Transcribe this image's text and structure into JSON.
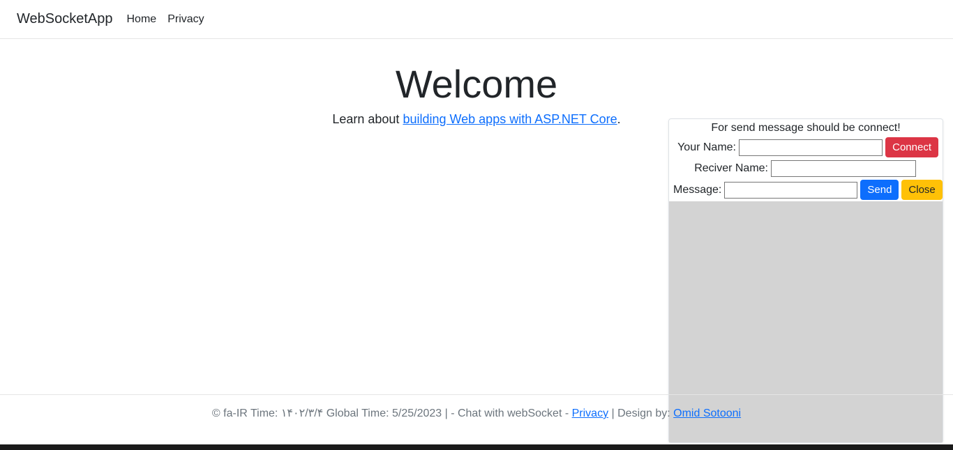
{
  "nav": {
    "brand": "WebSocketApp",
    "home": "Home",
    "privacy": "Privacy"
  },
  "main": {
    "title": "Welcome",
    "lead_prefix": "Learn about ",
    "lead_link": "building Web apps with ASP.NET Core",
    "lead_suffix": "."
  },
  "chat": {
    "header": "For send message should be connect!",
    "your_name_label": "Your Name:",
    "receiver_label": "Reciver Name:",
    "message_label": "Message:",
    "connect": "Connect",
    "send": "Send",
    "close": "Close"
  },
  "footer": {
    "prefix": "© fa-IR Time: ۱۴۰۲/۳/۴ Global Time: 5/25/2023 | - Chat with webSocket - ",
    "privacy": "Privacy",
    "mid": " | Design by: ",
    "designer": "Omid Sotooni"
  }
}
